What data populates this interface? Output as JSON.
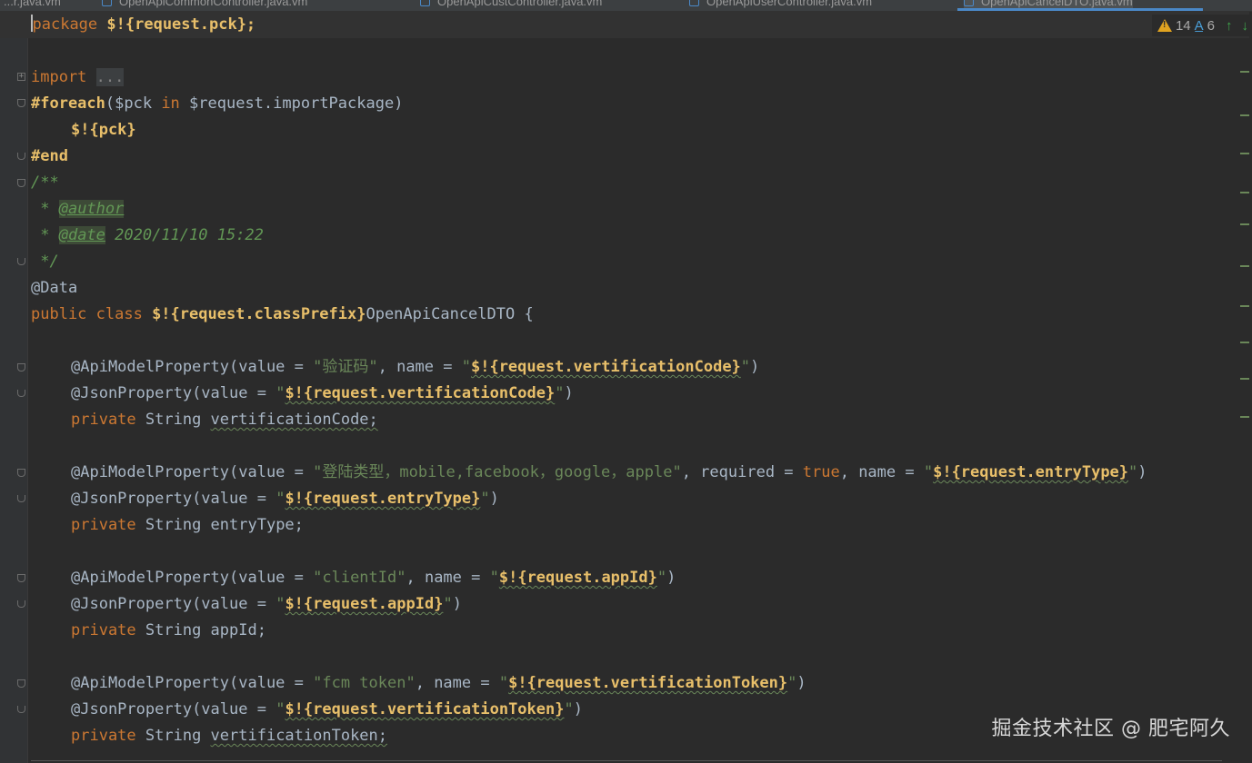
{
  "editor": {
    "tabs": [
      {
        "label": "...r.java.vm"
      },
      {
        "label": "OpenApiCommonController.java.vm"
      },
      {
        "label": "OpenApiCustController.java.vm"
      },
      {
        "label": "OpenApiUserController.java.vm"
      },
      {
        "label": "OpenApiCancelDTO.java.vm"
      }
    ],
    "status": {
      "warnings": "14",
      "typos": "6"
    },
    "watermark": "掘金技术社区 @ 肥宅阿久",
    "icons": [
      "warning-icon",
      "typo-icon",
      "arrow-up-icon",
      "arrow-down-icon",
      "fold-icon"
    ]
  },
  "code": {
    "package_kw": "package",
    "package_expr": "$!{request.pck};",
    "import_kw": "import",
    "import_fold": "...",
    "foreach_kw": "#foreach",
    "foreach_open": "($pck ",
    "foreach_in": "in",
    "foreach_rest": " $request.importPackage)",
    "foreach_body": "$!{pck}",
    "end_kw": "#end",
    "doc_open": "/**",
    "doc_star": " * ",
    "doc_author_tag": "@author",
    "doc_date_tag": "@date",
    "doc_date_val": " 2020/11/10 15:22",
    "doc_close": " */",
    "data_ann": "@Data",
    "class_kw": "public class ",
    "class_expr": "$!{request.classPrefix}",
    "class_name": "OpenApiCancelDTO {",
    "fields": [
      {
        "api_ann": "@ApiModelProperty",
        "api_open": "(value = ",
        "api_value": "\"验证码\"",
        "api_extra": ", name = ",
        "api_name_q1": "\"",
        "api_name_expr": "$!{request.vertificationCode}",
        "api_name_q2": "\"",
        "api_close": ")",
        "json_ann": "@JsonProperty",
        "json_open": "(value = ",
        "json_q1": "\"",
        "json_expr": "$!{request.vertificationCode}",
        "json_q2": "\"",
        "json_close": ")",
        "decl_kw": "private ",
        "decl_type": "String ",
        "decl_name": "vertificationCode;"
      },
      {
        "api_ann": "@ApiModelProperty",
        "api_open": "(value = ",
        "api_value": "\"登陆类型，mobile,facebook，google，apple\"",
        "api_extra": ", required = ",
        "api_true": "true",
        "api_extra2": ", name = ",
        "api_name_q1": "\"",
        "api_name_expr": "$!{request.entryType}",
        "api_name_q2": "\"",
        "api_close": ")",
        "json_ann": "@JsonProperty",
        "json_open": "(value = ",
        "json_q1": "\"",
        "json_expr": "$!{request.entryType}",
        "json_q2": "\"",
        "json_close": ")",
        "decl_kw": "private ",
        "decl_type": "String ",
        "decl_name": "entryType;"
      },
      {
        "api_ann": "@ApiModelProperty",
        "api_open": "(value = ",
        "api_value": "\"clientId\"",
        "api_extra": ", name = ",
        "api_name_q1": "\"",
        "api_name_expr": "$!{request.appId}",
        "api_name_q2": "\"",
        "api_close": ")",
        "json_ann": "@JsonProperty",
        "json_open": "(value = ",
        "json_q1": "\"",
        "json_expr": "$!{request.appId}",
        "json_q2": "\"",
        "json_close": ")",
        "decl_kw": "private ",
        "decl_type": "String ",
        "decl_name": "appId;"
      },
      {
        "api_ann": "@ApiModelProperty",
        "api_open": "(value = ",
        "api_value": "\"fcm token\"",
        "api_extra": ", name = ",
        "api_name_q1": "\"",
        "api_name_expr": "$!{request.vertificationToken}",
        "api_name_q2": "\"",
        "api_close": ")",
        "json_ann": "@JsonProperty",
        "json_open": "(value = ",
        "json_q1": "\"",
        "json_expr": "$!{request.vertificationToken}",
        "json_q2": "\"",
        "json_close": ")",
        "decl_kw": "private ",
        "decl_type": "String ",
        "decl_name": "vertificationToken;"
      }
    ]
  }
}
